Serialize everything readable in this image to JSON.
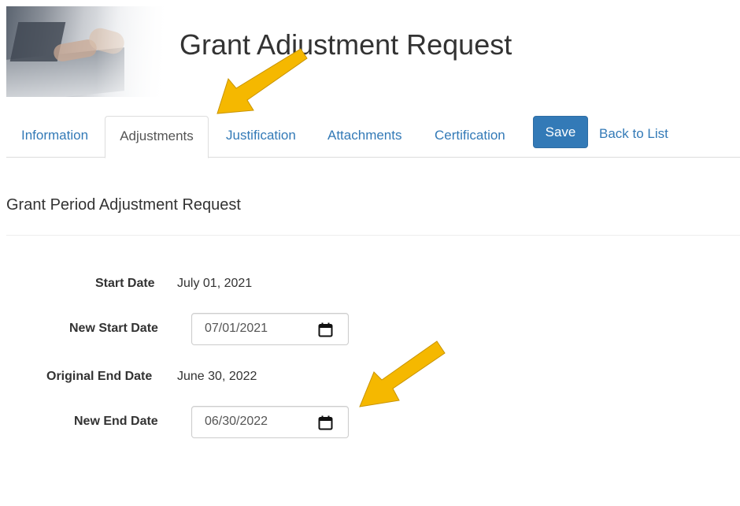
{
  "header": {
    "title": "Grant Adjustment Request"
  },
  "tabs": [
    {
      "label": "Information",
      "active": false
    },
    {
      "label": "Adjustments",
      "active": true
    },
    {
      "label": "Justification",
      "active": false
    },
    {
      "label": "Attachments",
      "active": false
    },
    {
      "label": "Certification",
      "active": false
    }
  ],
  "actions": {
    "save_label": "Save",
    "back_label": "Back to List"
  },
  "section": {
    "title": "Grant Period Adjustment Request"
  },
  "fields": {
    "start_date_label": "Start Date",
    "start_date_value": "July 01, 2021",
    "new_start_date_label": "New Start Date",
    "new_start_date_value": "07/01/2021",
    "original_end_date_label": "Original End Date",
    "original_end_date_value": "June 30, 2022",
    "new_end_date_label": "New End Date",
    "new_end_date_value": "06/30/2022"
  },
  "icons": {
    "calendar": "calendar-icon",
    "annotation_arrow": "arrow-icon"
  },
  "colors": {
    "link": "#337ab7",
    "primary_button": "#337ab7",
    "annotation_arrow": "#f5b800"
  }
}
